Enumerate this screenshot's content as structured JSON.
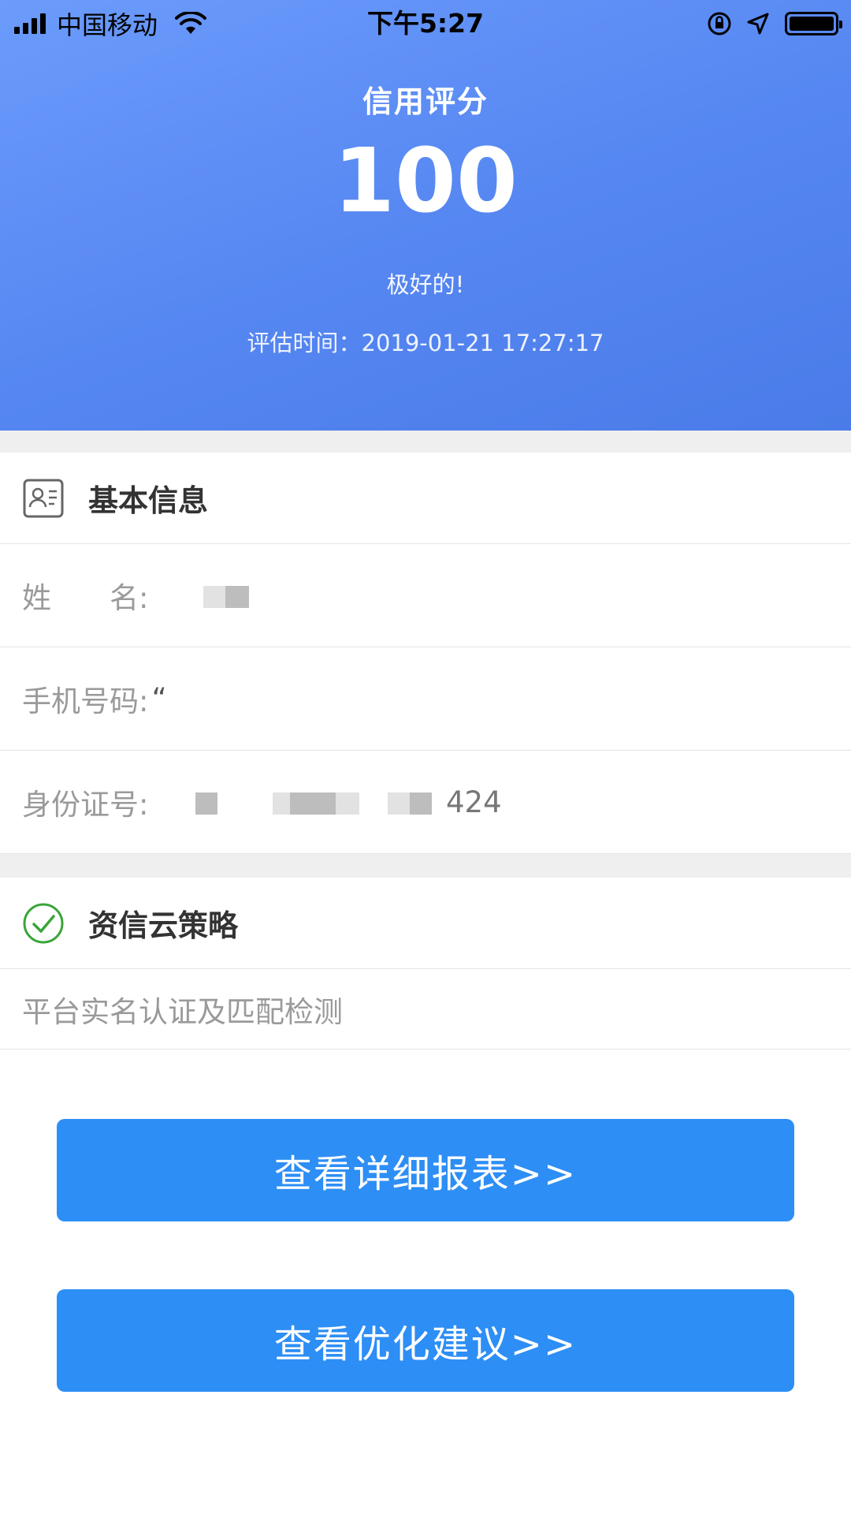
{
  "status_bar": {
    "carrier": "中国移动",
    "time": "下午5:27"
  },
  "header": {
    "title": "信用评分",
    "score": "100",
    "rating": "极好的!",
    "eval_time": "评估时间：2019-01-21 17:27:17"
  },
  "basic_info": {
    "title": "基本信息",
    "name_label": "姓　　名:",
    "phone_label": "手机号码:",
    "phone_value": "“",
    "id_label": "身份证号:",
    "id_suffix": "424"
  },
  "strategy": {
    "title": "资信云策略",
    "description": "平台实名认证及匹配检测"
  },
  "actions": {
    "report_button": "查看详细报表>>",
    "advice_button": "查看优化建议>>"
  },
  "colors": {
    "header_gradient_start": "#6b9bfb",
    "header_gradient_end": "#4a7be8",
    "button_blue": "#2d8ef5",
    "check_green": "#3aa53a"
  }
}
